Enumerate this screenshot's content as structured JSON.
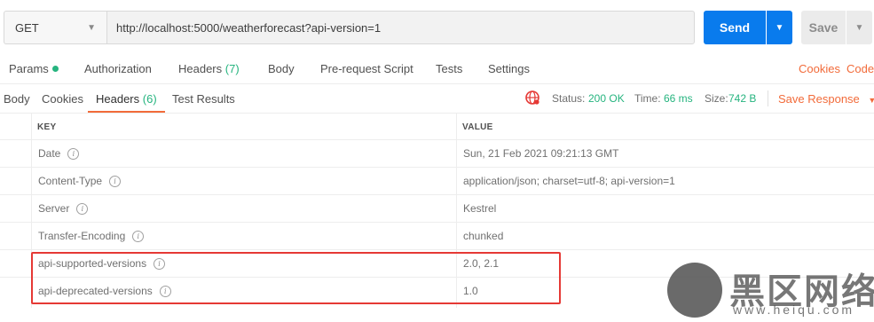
{
  "request": {
    "method": "GET",
    "url": "http://localhost:5000/weatherforecast?api-version=1",
    "send_label": "Send",
    "save_label": "Save"
  },
  "request_tabs": [
    {
      "label": "Params"
    },
    {
      "label": "Authorization"
    },
    {
      "label": "Headers",
      "count": "(7)"
    },
    {
      "label": "Body"
    },
    {
      "label": "Pre-request Script"
    },
    {
      "label": "Tests"
    },
    {
      "label": "Settings"
    }
  ],
  "right_links": {
    "cookies": "Cookies",
    "code": "Code"
  },
  "response_tabs": [
    {
      "label": "Body"
    },
    {
      "label": "Cookies"
    },
    {
      "label": "Headers",
      "count": "(6)"
    },
    {
      "label": "Test Results"
    }
  ],
  "response_status": {
    "status_label": "Status:",
    "status_value": "200 OK",
    "time_label": "Time:",
    "time_value": "66 ms",
    "size_label": "Size:",
    "size_value": "742 B",
    "save_response": "Save Response"
  },
  "headers_table": {
    "key_header": "KEY",
    "value_header": "VALUE",
    "rows": [
      {
        "key": "Date",
        "value": "Sun, 21 Feb 2021 09:21:13 GMT"
      },
      {
        "key": "Content-Type",
        "value": "application/json; charset=utf-8; api-version=1"
      },
      {
        "key": "Server",
        "value": "Kestrel"
      },
      {
        "key": "Transfer-Encoding",
        "value": "chunked"
      },
      {
        "key": "api-supported-versions",
        "value": "2.0, 2.1"
      },
      {
        "key": "api-deprecated-versions",
        "value": "1.0"
      }
    ]
  },
  "watermark": {
    "brand": "黑区网络",
    "url": "www.heiqu.com"
  },
  "colors": {
    "accent": "#f26b3a",
    "primary": "#097bed",
    "success": "#26b47f",
    "highlight": "#e53935"
  }
}
